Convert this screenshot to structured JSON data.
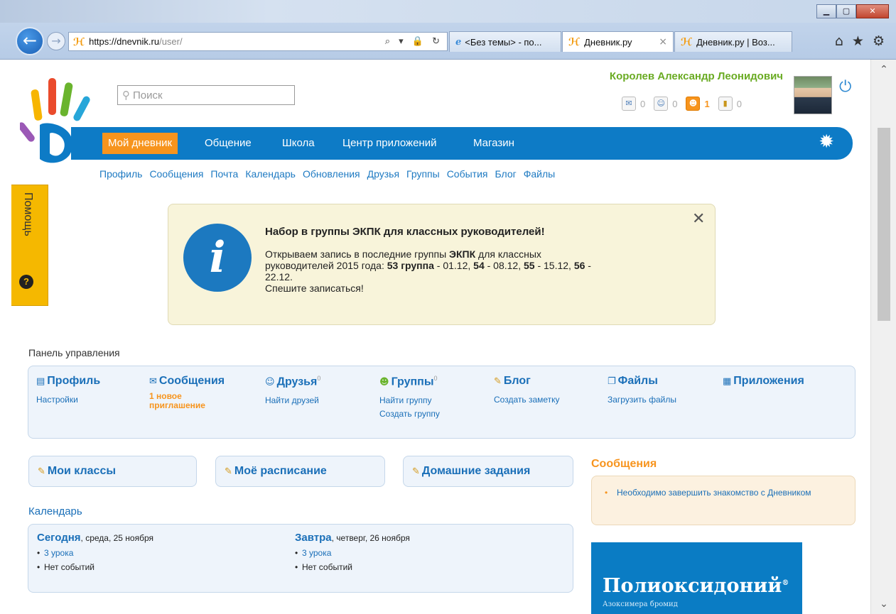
{
  "browser": {
    "url_host": "https://dnevnik.ru",
    "url_path": "/user/",
    "address_tools": "⌕ ▾ 🔒 ↻",
    "tabs": [
      {
        "label": "<Без темы> - по...",
        "icon": "ie-icon"
      },
      {
        "label": "Дневник.ру",
        "icon": "dnevnik-favicon",
        "close": "×"
      },
      {
        "label": "Дневник.ру | Воз...",
        "icon": "dnevnik-favicon"
      }
    ],
    "right_icons": [
      "home-icon",
      "favorites-star-icon",
      "settings-gear-icon"
    ]
  },
  "site": {
    "search_placeholder": "Поиск",
    "user_name": "Королев Александр Леонидович",
    "counters": [
      {
        "icon": "mail-icon",
        "value": "0",
        "highlight": false
      },
      {
        "icon": "person-icon",
        "value": "0",
        "highlight": false
      },
      {
        "icon": "invite-icon",
        "value": "1",
        "highlight": true
      },
      {
        "icon": "coins-icon",
        "value": "0",
        "highlight": false
      }
    ],
    "main_nav": [
      "Мой дневник",
      "Общение",
      "Школа",
      "Центр приложений",
      "Магазин"
    ],
    "sub_nav": [
      "Профиль",
      "Сообщения",
      "Почта",
      "Календарь",
      "Обновления",
      "Друзья",
      "Группы",
      "События",
      "Блог",
      "Файлы"
    ],
    "help_label": "Помощь",
    "help_icon_glyph": "?"
  },
  "notice": {
    "title": "Набор в группы ЭКПК для классных руководителей!",
    "line1_pre": "Открываем запись в последние группы ",
    "line1_bold": "ЭКПК",
    "line1_post": " для классных",
    "line2_pre": "руководителей 2015 года: ",
    "g53": "53 группа",
    "d53": " - 01.12, ",
    "g54": "54",
    "d54": " - 08.12, ",
    "g55": "55",
    "d55": " - 15.12, ",
    "g56": "56",
    "d56": " -",
    "line3": "22.12.",
    "line4": "Спешите записаться!",
    "icon_glyph": "i",
    "close_glyph": "✕"
  },
  "control_panel": {
    "label": "Панель управления",
    "profile": {
      "title": "Профиль",
      "link1": "Настройки"
    },
    "messages": {
      "title": "Сообщения",
      "alert_line1": "1 новое",
      "alert_line2": "приглашение"
    },
    "friends": {
      "title": "Друзья",
      "count": "0",
      "link1": "Найти друзей"
    },
    "groups": {
      "title": "Группы",
      "count": "0",
      "link1": "Найти группу",
      "link2": "Создать группу"
    },
    "blog": {
      "title": "Блог",
      "link1": "Создать заметку"
    },
    "files": {
      "title": "Файлы",
      "link1": "Загрузить файлы"
    },
    "apps": {
      "title": "Приложения"
    }
  },
  "quick_buttons": [
    "Мои классы",
    "Моё расписание",
    "Домашние задания"
  ],
  "messages_widget": {
    "title": "Сообщения",
    "item": "Необходимо завершить знакомство с Дневником"
  },
  "calendar": {
    "title": "Календарь",
    "today": {
      "word": "Сегодня",
      "rest": ", среда, 25 ноября",
      "lessons": "3 урока",
      "events": "Нет событий"
    },
    "tomorrow": {
      "word": "Завтра",
      "rest": ", четверг, 26 ноября",
      "lessons": "3 урока",
      "events": "Нет событий"
    }
  },
  "ad": {
    "brand": "Полиоксидоний",
    "reg_mark": "®",
    "subtitle": "Азоксимера бромид"
  }
}
